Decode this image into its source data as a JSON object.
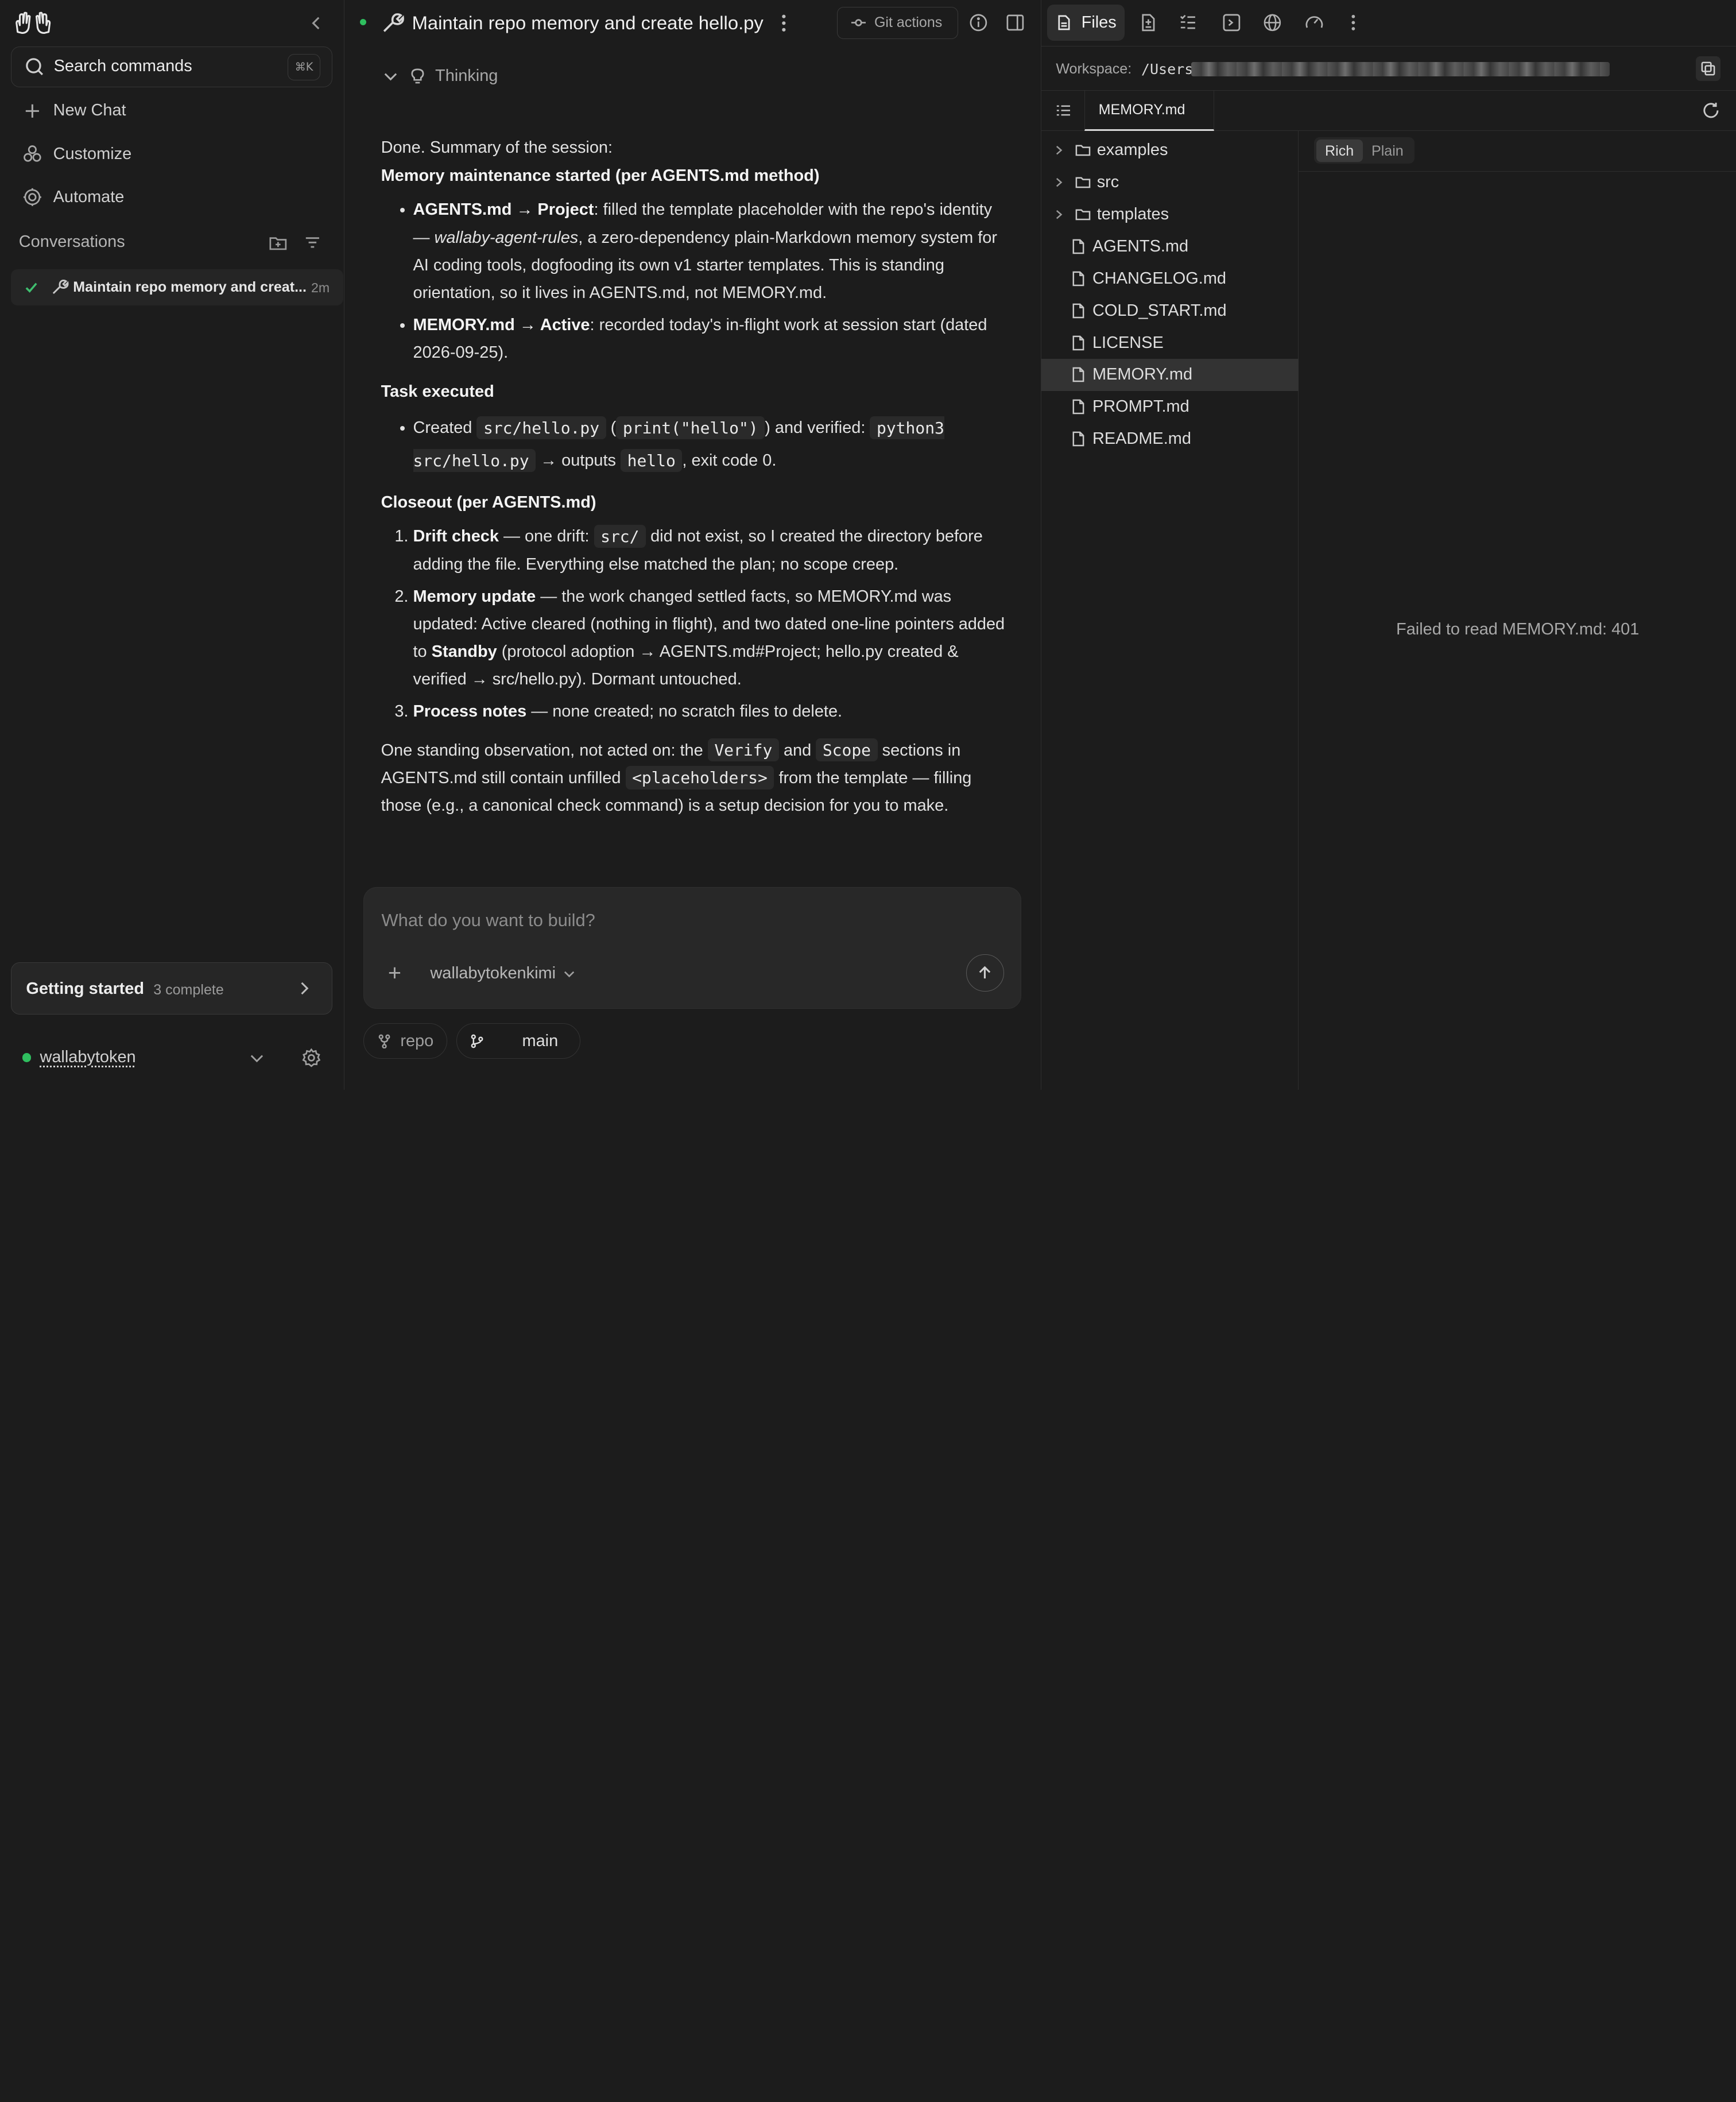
{
  "sidebar": {
    "search_label": "Search commands",
    "search_shortcut": "⌘K",
    "nav": [
      {
        "label": "New Chat",
        "icon": "plus-icon"
      },
      {
        "label": "Customize",
        "icon": "customize-icon"
      },
      {
        "label": "Automate",
        "icon": "automate-icon"
      }
    ],
    "conversations_label": "Conversations",
    "conversation": {
      "title": "Maintain repo memory and creat...",
      "time": "2m",
      "status": "complete"
    },
    "getting_started": {
      "title": "Getting started",
      "subtitle": "3 complete"
    },
    "user": {
      "name": "wallabytoken",
      "status_color": "#2fbf5f"
    }
  },
  "chat": {
    "title": "Maintain repo memory and create hello.py",
    "git_actions_label": "Git actions",
    "thinking_label": "Thinking",
    "message": {
      "intro": "Done. Summary of the session:",
      "memory_heading": "Memory maintenance started (per AGENTS.md method)",
      "b1_strong": "AGENTS.md → Project",
      "b1_text1": ": filled the template placeholder with the repo's identity — ",
      "b1_em": "wallaby-agent-rules",
      "b1_text2": ", a zero-dependency plain-Markdown memory system for AI coding tools, dogfooding its own v1 starter templates. This is standing orientation, so it lives in AGENTS.md, not MEMORY.md.",
      "b2_strong": "MEMORY.md → Active",
      "b2_text": ": recorded today's in-flight work at session start (dated 2026-09-25).",
      "task_heading": "Task executed",
      "t1_a": "Created ",
      "t1_code1": "src/hello.py",
      "t1_b": " (",
      "t1_code2": "print(\"hello\")",
      "t1_c": ") and verified: ",
      "t1_code3": "python3 src/hello.py",
      "t1_d": " → outputs ",
      "t1_code4": "hello",
      "t1_e": ", exit code 0.",
      "closeout_heading": "Closeout (per AGENTS.md)",
      "c1_strong": "Drift check",
      "c1_a": " — one drift: ",
      "c1_code": "src/",
      "c1_b": " did not exist, so I created the directory before adding the file. Everything else matched the plan; no scope creep.",
      "c2_strong": "Memory update",
      "c2_a": " — the work changed settled facts, so MEMORY.md was updated: Active cleared (nothing in flight), and two dated one-line pointers added to ",
      "c2_strong2": "Standby",
      "c2_b": " (protocol adoption → AGENTS.md#Project; hello.py created & verified → src/hello.py). Dormant untouched.",
      "c3_strong": "Process notes",
      "c3_a": " — none created; no scratch files to delete.",
      "obs_a": "One standing observation, not acted on: the ",
      "obs_code1": "Verify",
      "obs_b": " and ",
      "obs_code2": "Scope",
      "obs_c": " sections in AGENTS.md still contain unfilled ",
      "obs_code3": "<placeholders>",
      "obs_d": " from the template — filling those (e.g., a canonical check command) is a setup decision for you to make."
    },
    "composer": {
      "placeholder": "What do you want to build?",
      "model": "wallabytokenkimi"
    },
    "chips": {
      "repo": "repo",
      "branch": "main"
    }
  },
  "panel": {
    "tabs": [
      {
        "label": "Files",
        "icon": "file-icon",
        "active": true
      },
      {
        "icon": "diff-file-icon"
      },
      {
        "icon": "checklist-icon"
      },
      {
        "icon": "terminal-icon"
      },
      {
        "icon": "globe-icon"
      },
      {
        "icon": "gauge-icon"
      },
      {
        "icon": "more-icon"
      }
    ],
    "workspace_label": "Workspace:",
    "workspace_path": "/Users",
    "open_file": "MEMORY.md",
    "tree": [
      {
        "name": "examples",
        "type": "folder"
      },
      {
        "name": "src",
        "type": "folder"
      },
      {
        "name": "templates",
        "type": "folder"
      },
      {
        "name": "AGENTS.md",
        "type": "file"
      },
      {
        "name": "CHANGELOG.md",
        "type": "file"
      },
      {
        "name": "COLD_START.md",
        "type": "file"
      },
      {
        "name": "LICENSE",
        "type": "file"
      },
      {
        "name": "MEMORY.md",
        "type": "file",
        "selected": true
      },
      {
        "name": "PROMPT.md",
        "type": "file"
      },
      {
        "name": "README.md",
        "type": "file"
      }
    ],
    "view_modes": {
      "rich": "Rich",
      "plain": "Plain",
      "active": "Rich"
    },
    "error_message": "Failed to read MEMORY.md: 401"
  }
}
